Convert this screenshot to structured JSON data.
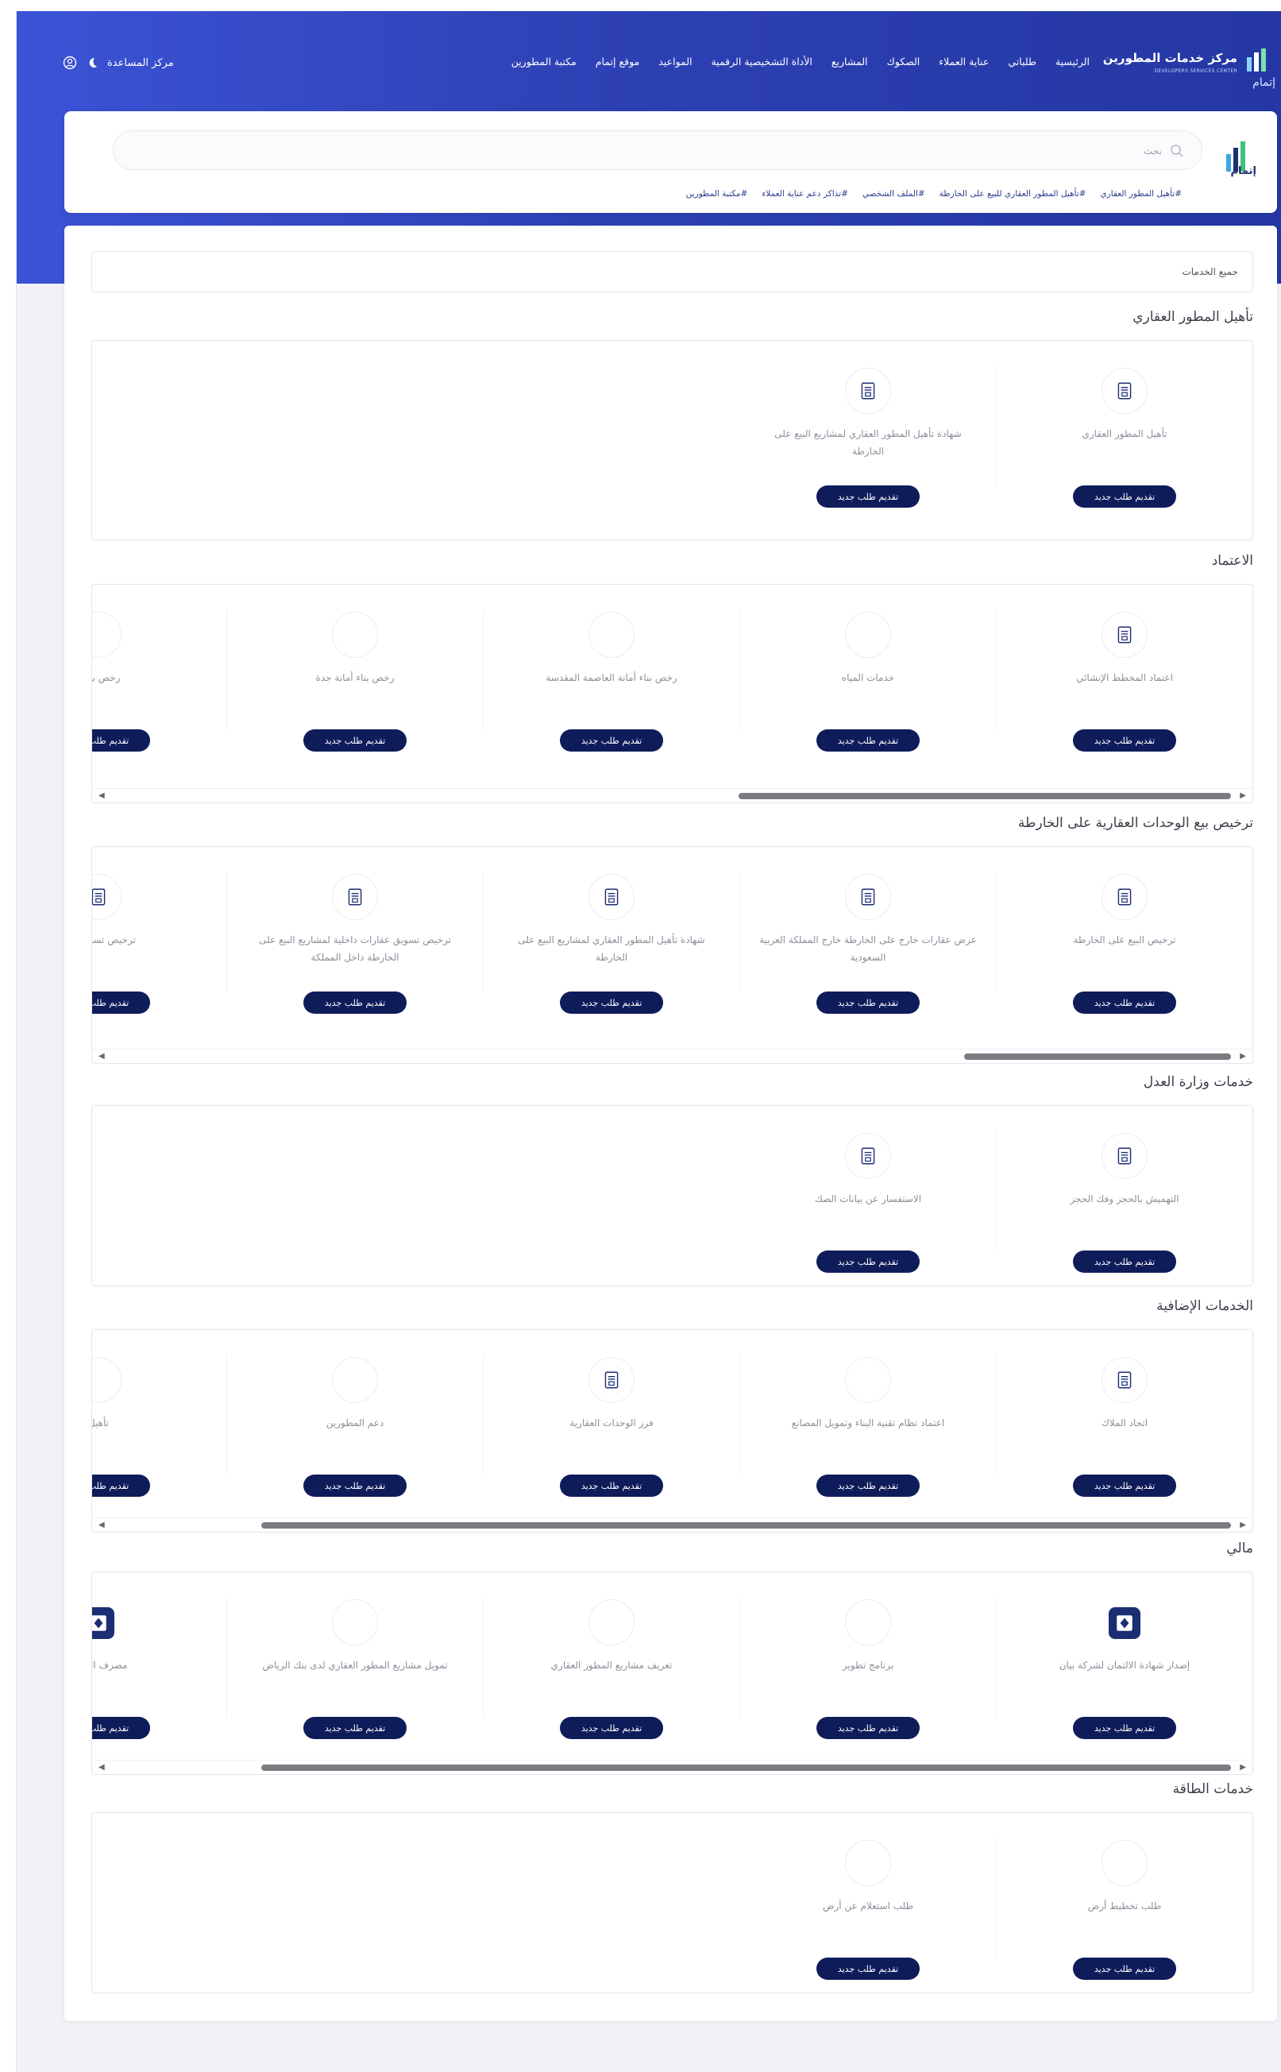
{
  "header": {
    "brand_title": "مركز خدمات المطورين",
    "brand_subtitle": "DEVELOPERS SERVICES CENTER",
    "brand_small": "إتمام",
    "nav": [
      "الرئيسية",
      "طلباتي",
      "عناية العملاء",
      "الصكوك",
      "المشاريع",
      "الأداة التشخيصية الرقمية",
      "المواعيد",
      "موقع إتمام",
      "مكتبة المطورين"
    ],
    "help_label": "مركز المساعدة"
  },
  "search": {
    "placeholder": "بحث",
    "logo_text": "إتمام",
    "quick_links": [
      "#تأهيل المطور العقاري",
      "#تأهيل المطور العقاري للبيع على الخارطة",
      "#الملف الشخصي",
      "#تذاكر دعم عناية العملاء",
      "#مكتبة المطورين"
    ]
  },
  "filter": {
    "label": "جميع الخدمات"
  },
  "button_label": "تقديم طلب جديد",
  "sections": [
    {
      "title": "تأهيل المطور العقاري",
      "cards": [
        "تأهيل المطور العقاري",
        "شهادة تأهيل المطور العقاري لمشاريع البيع على الخارطة"
      ]
    },
    {
      "title": "الاعتماد",
      "cards": [
        "اعتماد المخطط الإنشائي",
        "خدمات المياه",
        "رخص بناء أمانة العاصمة المقدسة",
        "رخص بناء أمانة جدة",
        "رخص بناء أ"
      ]
    },
    {
      "title": "ترخيص بيع الوحدات العقارية على الخارطة",
      "cards": [
        "ترخيص البيع على الخارطة",
        "عرض عقارات خارج على الخارطة خارج المملكة العربية السعودية",
        "شهادة تأهيل المطور العقاري لمشاريع البيع على الخارطة",
        "ترخيص تسويق عقارات داخلية لمشاريع البيع على الخارطة داخل المملكة",
        "ترخيص تسويق عقا"
      ]
    },
    {
      "title": "خدمات وزارة العدل",
      "cards": [
        "التهميش بالحجز وفك الحجز",
        "الاستفسار عن بيانات الصك"
      ]
    },
    {
      "title": "الخدمات الإضافية",
      "cards": [
        "اتحاد الملاك",
        "اعتماد نظام تقنية البناء وتمويل المصانع",
        "فرز الوحدات العقارية",
        "دعم المطورين",
        "تأهيل"
      ]
    },
    {
      "title": "مالي",
      "cards": [
        "إصدار شهادة الالتمان لشركة بيان",
        "برنامج تطوير",
        "تعريف مشاريع المطور العقاري",
        "تمويل مشاريع المطور العقاري لدى بنك الرياض",
        "مصرف الوحدة"
      ]
    },
    {
      "title": "خدمات الطاقة",
      "cards": [
        "طلب تخطيط أرض",
        "طلب استعلام عن أرض"
      ]
    }
  ]
}
